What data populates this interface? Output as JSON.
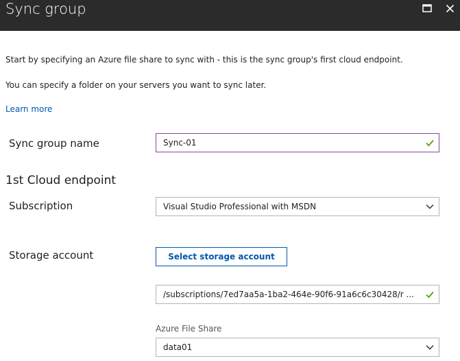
{
  "window": {
    "title": "Sync group",
    "maximize_icon": "maximize-icon",
    "close_icon": "close-icon"
  },
  "intro": {
    "line1": "Start by specifying an Azure file share to sync with - this is the sync group's first cloud endpoint.",
    "line2": "You can specify a folder on your servers you want to sync later.",
    "learn_more": "Learn more"
  },
  "sync_group_name": {
    "label": "Sync group name",
    "value": "Sync-01",
    "valid": true
  },
  "cloud_endpoint": {
    "heading": "1st Cloud endpoint",
    "subscription": {
      "label": "Subscription",
      "value": "Visual Studio Professional with MSDN"
    },
    "storage_account": {
      "label": "Storage account",
      "button_label": "Select storage account",
      "path_value": "/subscriptions/7ed7aa5a-1ba2-464e-90f6-91a6c6c30428/r ...",
      "valid": true
    },
    "file_share": {
      "label": "Azure File Share",
      "value": "data01"
    }
  },
  "colors": {
    "titlebar": "#2b2b2b",
    "accent_link": "#0058ad",
    "valid_check": "#57a300",
    "focus_border": "#804998"
  }
}
